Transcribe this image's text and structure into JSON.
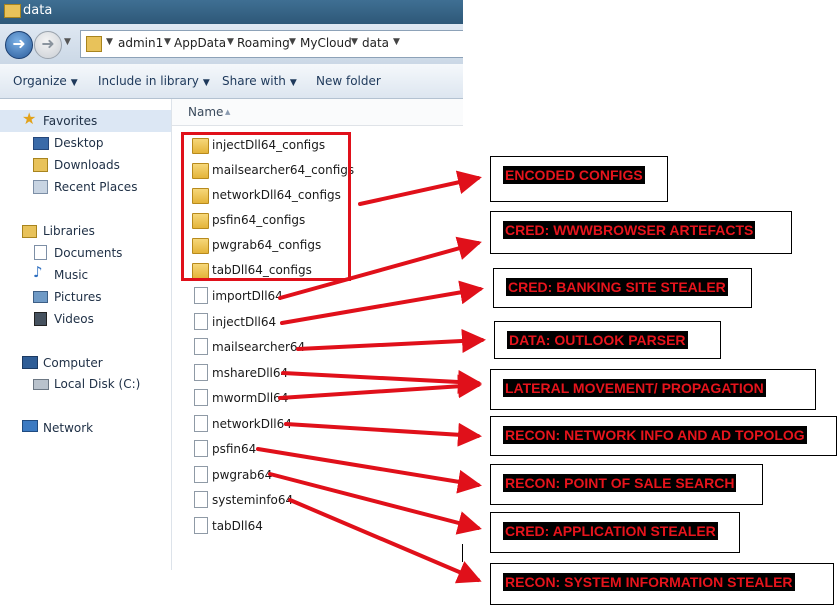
{
  "window": {
    "title": "data",
    "folder_icon": "folder-icon"
  },
  "address_bar": {
    "breadcrumb": [
      "admin1",
      "AppData",
      "Roaming",
      "MyCloud",
      "data"
    ],
    "separator_glyph": "▸"
  },
  "toolbar": {
    "organize": "Organize",
    "include_in_library": "Include in library",
    "share_with": "Share with",
    "new_folder": "New folder"
  },
  "nav_pane": {
    "favorites": "Favorites",
    "desktop": "Desktop",
    "downloads": "Downloads",
    "recent_places": "Recent Places",
    "libraries": "Libraries",
    "documents": "Documents",
    "music": "Music",
    "pictures": "Pictures",
    "videos": "Videos",
    "computer": "Computer",
    "local_disk": "Local Disk (C:)",
    "network": "Network"
  },
  "file_list": {
    "column_header": "Name",
    "folders": [
      "injectDll64_configs",
      "mailsearcher64_configs",
      "networkDll64_configs",
      "psfin64_configs",
      "pwgrab64_configs",
      "tabDll64_configs"
    ],
    "files": [
      "importDll64",
      "injectDll64",
      "mailsearcher64",
      "mshareDll64",
      "mwormDll64",
      "networkDll64",
      "psfin64",
      "pwgrab64",
      "systeminfo64",
      "tabDll64"
    ]
  },
  "annotations": {
    "encoded_configs": "ENCODED CONFIGS",
    "wwwbrowser": "CRED: WWWBROWSER ARTEFACTS",
    "banking": "CRED: BANKING SITE STEALER",
    "outlook": "DATA: OUTLOOK PARSER",
    "lateral": "LATERAL MOVEMENT/ PROPAGATION",
    "network_info": "RECON: NETWORK INFO AND AD TOPOLOG",
    "pos": "RECON: POINT OF SALE SEARCH",
    "app_stealer": "CRED: APPLICATION STEALER",
    "sysinfo": "RECON: SYSTEM INFORMATION STEALER"
  },
  "colors": {
    "annotation_red": "#e0101a",
    "label_background": "#000000",
    "label_text": "#e6141c"
  }
}
